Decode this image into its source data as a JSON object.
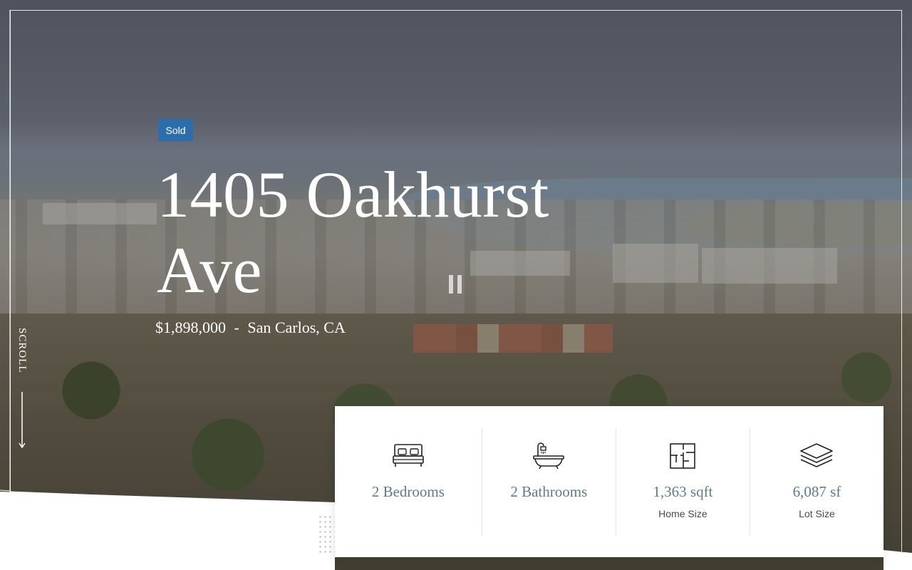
{
  "listing": {
    "status": "Sold",
    "address_line": "1405 Oakhurst Ave",
    "price": "$1,898,000",
    "separator": "-",
    "location": "San Carlos, CA"
  },
  "hero": {
    "scroll_label": "SCROLL",
    "pause_icon": "pause-icon"
  },
  "stats": [
    {
      "icon": "bed-icon",
      "value": "2 Bedrooms",
      "label": ""
    },
    {
      "icon": "bathtub-icon",
      "value": "2 Bathrooms",
      "label": ""
    },
    {
      "icon": "floor-plan-icon",
      "value": "1,363 sqft",
      "label": "Home Size"
    },
    {
      "icon": "layers-icon",
      "value": "6,087 sf",
      "label": "Lot Size"
    }
  ],
  "colors": {
    "badge": "#2c6eab",
    "stat_value": "#5a7c8c",
    "stat_label": "#4a4a4a"
  }
}
